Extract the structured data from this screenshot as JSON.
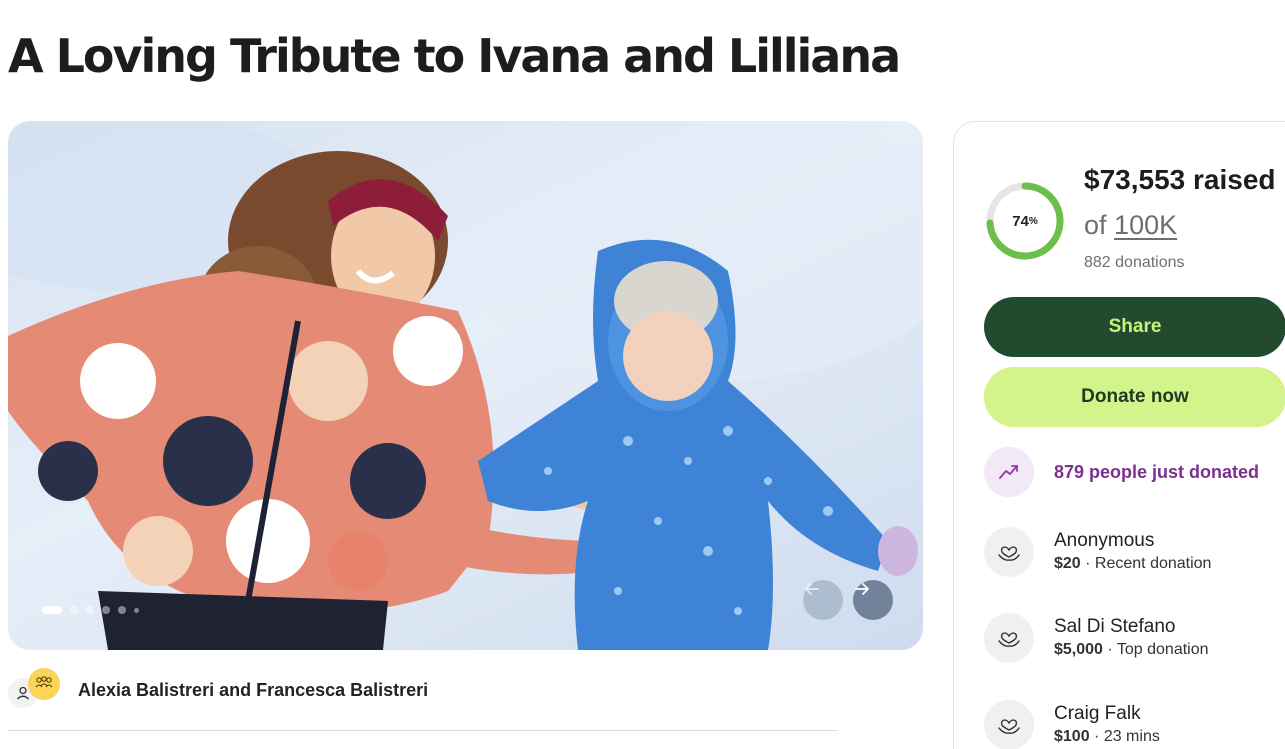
{
  "page": {
    "title": "A Loving Tribute to Ivana and Lilliana"
  },
  "carousel": {
    "slide_count": 6,
    "active_slide": 1,
    "prev_icon": "arrow-left-icon",
    "next_icon": "arrow-right-icon"
  },
  "organizers": {
    "names": "Alexia Balistreri and Francesca Balistreri"
  },
  "donation": {
    "progress_value": "74",
    "progress_unit": "%",
    "progress_fraction": 0.74,
    "raised": "$73,553 raised",
    "goal_prefix": "of",
    "goal": "100K",
    "donations_count": "882 donations"
  },
  "buttons": {
    "share": "Share",
    "donate": "Donate now"
  },
  "trending": {
    "text": "879 people just donated",
    "icon": "trending-up-icon"
  },
  "recent_donors": [
    {
      "name": "Anonymous",
      "amount": "$20",
      "separator": " · ",
      "note": "Recent donation"
    },
    {
      "name": "Sal Di Stefano",
      "amount": "$5,000",
      "separator": " · ",
      "note": "Top donation"
    },
    {
      "name": "Craig Falk",
      "amount": "$100",
      "separator": " · ",
      "note": "23 mins"
    }
  ],
  "colors": {
    "share_bg": "#214a2e",
    "share_text": "#c9f27b",
    "donate_bg": "#d2f48a",
    "progress": "#6cc04a",
    "trending_text": "#7d2f8e"
  }
}
